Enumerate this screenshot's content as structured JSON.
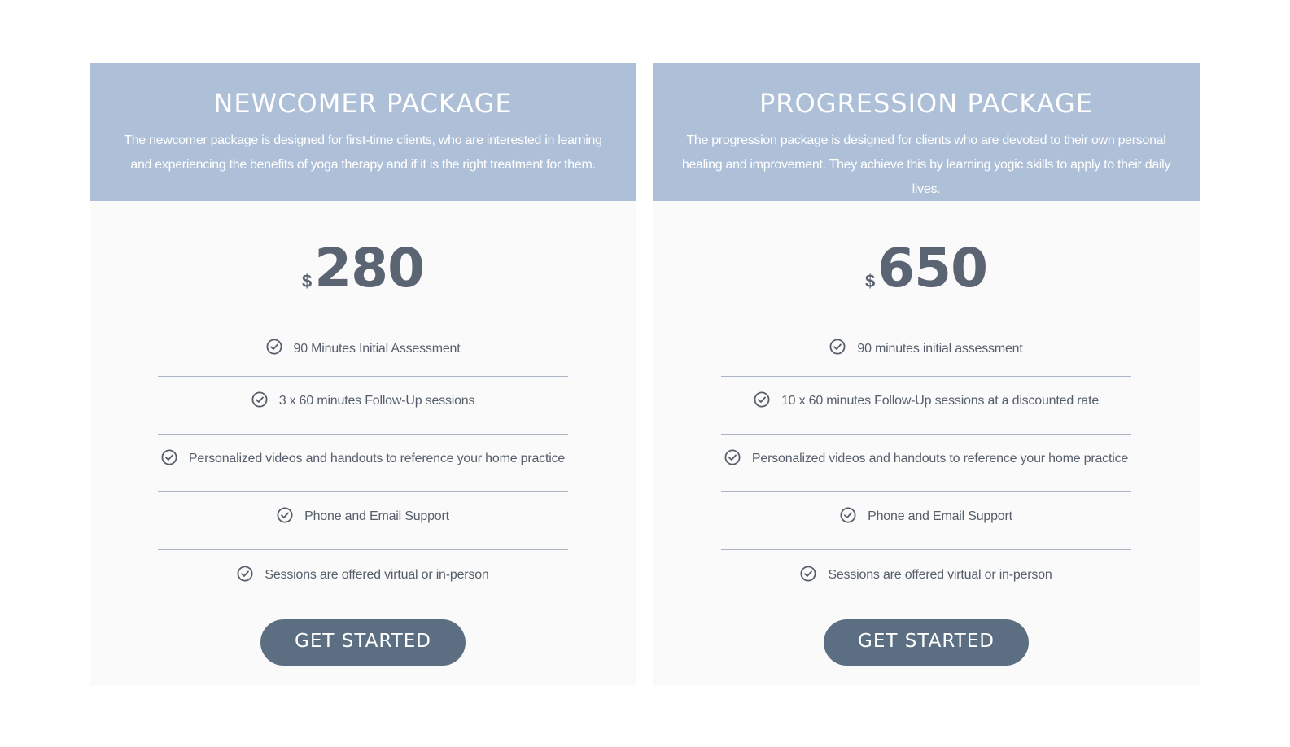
{
  "packages": [
    {
      "title": "NEWCOMER PACKAGE",
      "description": "The newcomer package is designed for first-time clients, who are interested in learning and experiencing the benefits of yoga therapy and if it is the right treatment for them.",
      "currency": "$",
      "price": "280",
      "features": [
        "90 Minutes Initial Assessment",
        "3 x 60 minutes Follow-Up sessions",
        "Personalized videos and handouts to reference your home practice",
        "Phone and Email Support",
        "Sessions are offered virtual or in-person"
      ],
      "cta_label": "GET STARTED"
    },
    {
      "title": "PROGRESSION PACKAGE",
      "description": "The progression package is designed for clients who are devoted to their own personal healing and improvement. They achieve this by learning yogic skills to apply to their daily lives.",
      "currency": "$",
      "price": "650",
      "features": [
        "90 minutes initial assessment",
        "10 x 60 minutes Follow-Up sessions at a discounted rate",
        "Personalized videos and handouts to reference your home practice",
        "Phone and Email Support",
        "Sessions are offered virtual or in-person"
      ],
      "cta_label": "GET STARTED"
    }
  ],
  "icons": {
    "feature_icon": "check-circle-icon"
  },
  "colors": {
    "header_bg": "#aebfd8",
    "card_bg": "#fafafa",
    "button_bg": "#5b6e82",
    "text": "#555e6a",
    "price": "#5a6472"
  }
}
